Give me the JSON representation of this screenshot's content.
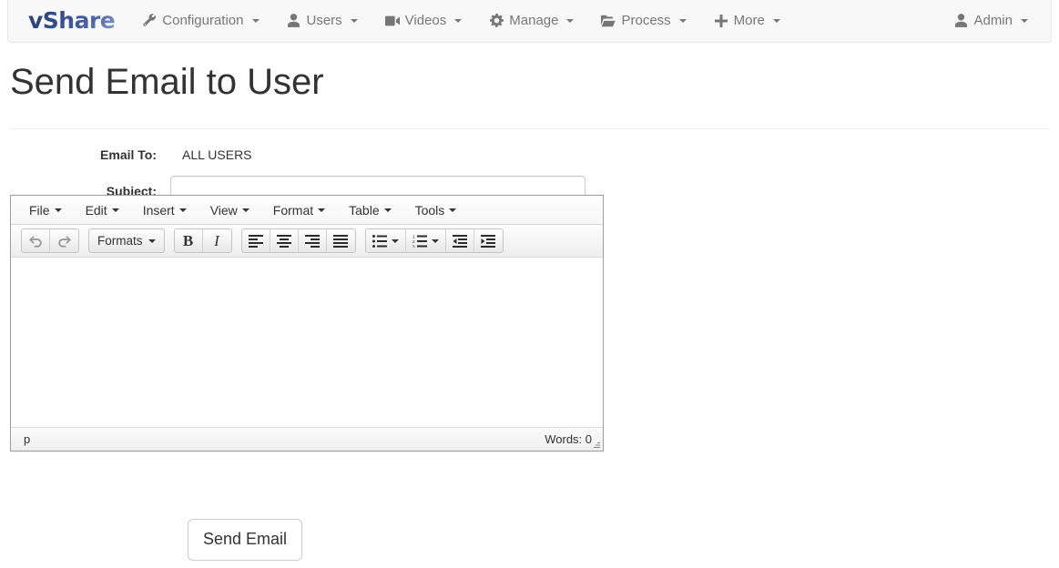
{
  "navbar": {
    "brand": "vShare",
    "items": [
      {
        "label": "Configuration",
        "icon": "wrench-icon",
        "caret": true
      },
      {
        "label": "Users",
        "icon": "user-icon",
        "caret": true
      },
      {
        "label": "Videos",
        "icon": "video-camera-icon",
        "caret": true
      },
      {
        "label": "Manage",
        "icon": "gear-icon",
        "caret": true
      },
      {
        "label": "Process",
        "icon": "folder-open-icon",
        "caret": true
      },
      {
        "label": "More",
        "icon": "plus-icon",
        "caret": true
      }
    ],
    "right": {
      "label": "Admin",
      "icon": "user-icon",
      "caret": true
    }
  },
  "page": {
    "title": "Send Email to User"
  },
  "form": {
    "email_to_label": "Email To:",
    "email_to_value": "ALL USERS",
    "subject_label": "Subject:",
    "subject_value": "",
    "subject_placeholder": "",
    "submit_label": "Send Email"
  },
  "editor": {
    "menubar": [
      {
        "label": "File"
      },
      {
        "label": "Edit"
      },
      {
        "label": "Insert"
      },
      {
        "label": "View"
      },
      {
        "label": "Format"
      },
      {
        "label": "Table"
      },
      {
        "label": "Tools"
      }
    ],
    "toolbar": [
      {
        "name": "undo-icon",
        "label": ""
      },
      {
        "name": "redo-icon",
        "label": ""
      },
      {
        "name": "formats-dropdown",
        "label": "Formats"
      },
      {
        "name": "bold-icon",
        "label": "B"
      },
      {
        "name": "italic-icon",
        "label": "I"
      },
      {
        "name": "align-left-icon",
        "label": ""
      },
      {
        "name": "align-center-icon",
        "label": ""
      },
      {
        "name": "align-right-icon",
        "label": ""
      },
      {
        "name": "align-justify-icon",
        "label": ""
      },
      {
        "name": "bullet-list-icon",
        "label": ""
      },
      {
        "name": "numbered-list-icon",
        "label": ""
      },
      {
        "name": "outdent-icon",
        "label": ""
      },
      {
        "name": "indent-icon",
        "label": ""
      }
    ],
    "body_content": "",
    "statusbar": {
      "path": "p",
      "word_count": "Words: 0"
    }
  },
  "colors": {
    "brand_blue": "#33498a",
    "navbar_bg": "#f8f8f8",
    "nav_text": "#777777",
    "page_text": "#333333",
    "border": "#cccccc",
    "editor_border": "#9e9e9e"
  }
}
